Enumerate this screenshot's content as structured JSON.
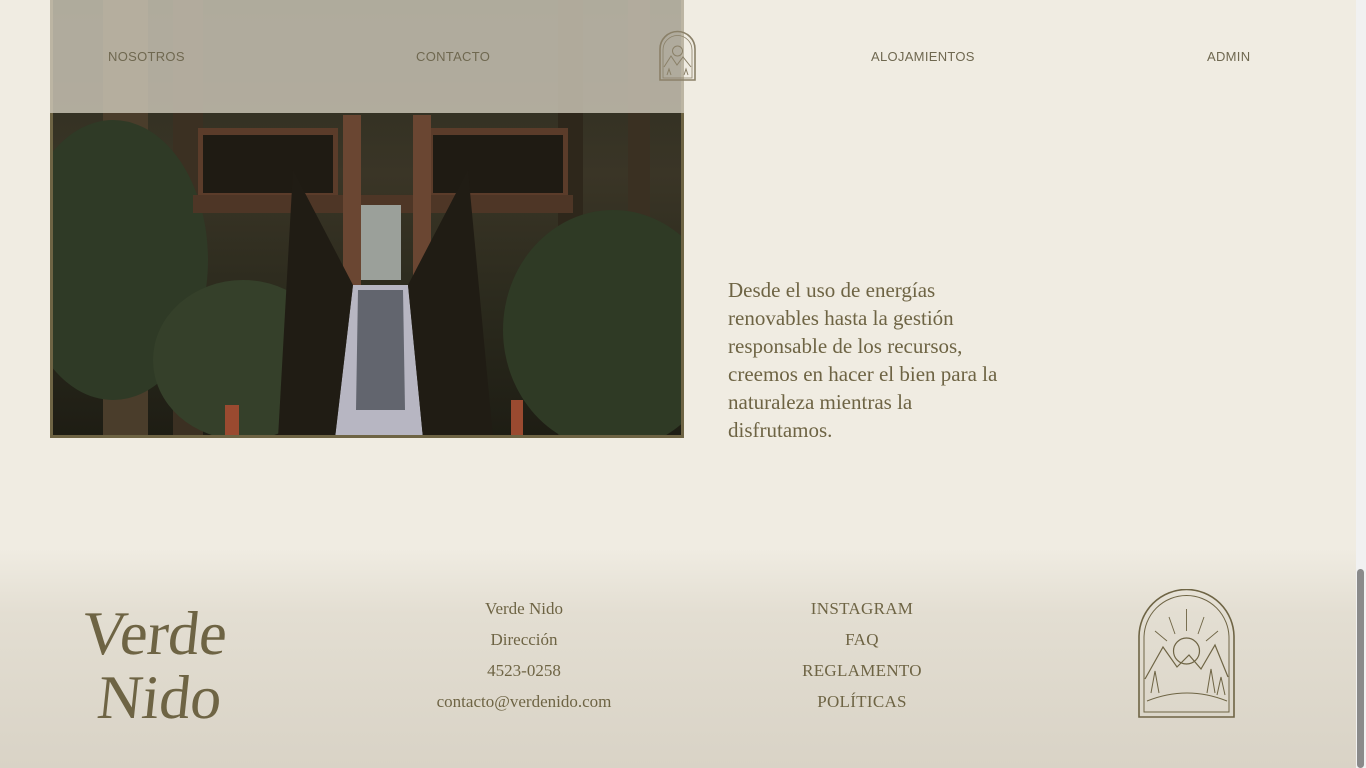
{
  "nav": {
    "items": [
      "NOSOTROS",
      "CONTACTO",
      "ALOJAMIENTOS",
      "ADMIN"
    ]
  },
  "logo_icon": "mountain-sun-arch-icon",
  "main": {
    "blurb": "Desde el uso de energías renovables hasta la gestión responsable de los recursos, creemos en hacer el bien para la naturaleza mientras la disfrutamos."
  },
  "footer": {
    "wordmark_line1": "Verde",
    "wordmark_line2": "Nido",
    "info": [
      "Verde Nido",
      "Dirección",
      "4523-0258",
      "contacto@verdenido.com"
    ],
    "links": [
      "INSTAGRAM",
      "FAQ",
      "REGLAMENTO",
      "POLÍTICAS"
    ]
  },
  "colors": {
    "background": "#f0ece2",
    "accent": "#6e6444"
  }
}
